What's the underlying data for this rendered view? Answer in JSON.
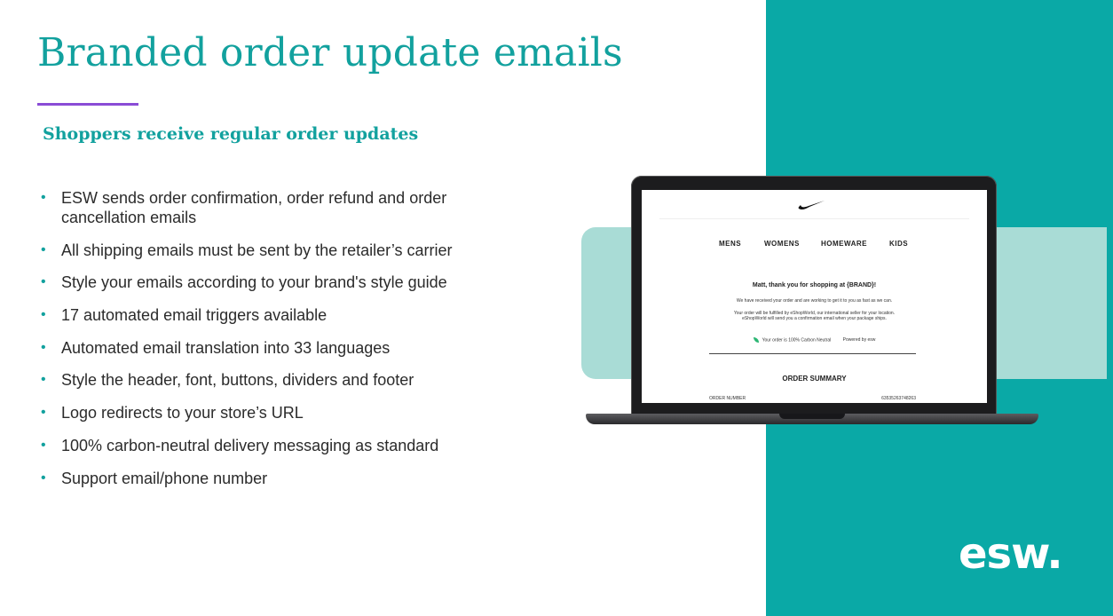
{
  "slide": {
    "title": "Branded order update emails",
    "subtitle": "Shoppers receive regular order updates",
    "bullet_symbol": "•",
    "bullets": [
      "ESW sends order confirmation, order refund and order cancellation emails",
      "All shipping emails must be sent by the retailer’s carrier",
      "Style your emails according to your brand's style guide",
      "17 automated email triggers available",
      "Automated email translation into 33 languages",
      "Style the header, font, buttons, dividers and footer",
      "Logo redirects to your store’s URL",
      "100% carbon-neutral delivery messaging as standard",
      "Support email/phone number"
    ]
  },
  "email_preview": {
    "brand_logo_icon": "swoosh-logo",
    "nav": [
      "MENS",
      "WOMENS",
      "HOMEWARE",
      "KIDS"
    ],
    "greeting": "Matt, thank you for shopping at {BRAND}!",
    "line1": "We have received your order and are working to get it to you as fast as we can.",
    "line2": "Your order will be fulfilled by eShopWorld, our international seller for your location.",
    "line3": "eShopWorld will send you a confirmation email when your package ships.",
    "carbon": "Your order is 100% Carbon Neutral",
    "powered_by": "Powered by esw",
    "summary_title": "ORDER SUMMARY",
    "order_number_label": "ORDER NUMBER",
    "order_number_value": "63535263748263"
  },
  "brand": {
    "logo_text": "esw.",
    "colors": {
      "teal": "#0aa9a6",
      "mint": "#a9dcd6",
      "accent_purple": "#8a4cd6",
      "text_teal": "#12a19e"
    }
  }
}
